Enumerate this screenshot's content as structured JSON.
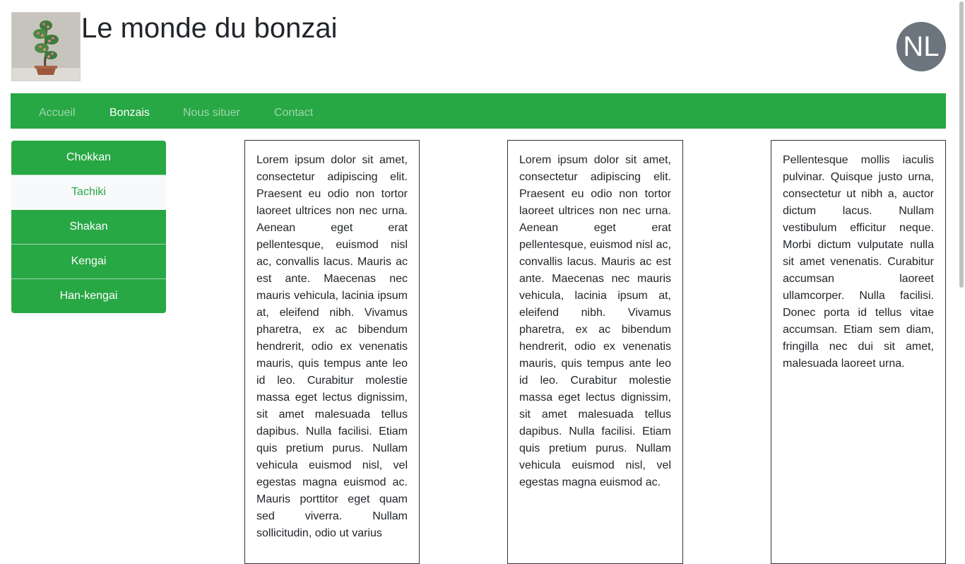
{
  "header": {
    "title": "Le monde du bonzai",
    "avatar_initials": "NL",
    "logo_alt": "bonsai tree"
  },
  "navbar": {
    "items": [
      {
        "label": "Accueil",
        "active": false
      },
      {
        "label": "Bonzais",
        "active": true
      },
      {
        "label": "Nous situer",
        "active": false
      },
      {
        "label": "Contact",
        "active": false
      }
    ],
    "background": "#28a745"
  },
  "sidebar": {
    "items": [
      {
        "label": "Chokkan",
        "active": false
      },
      {
        "label": "Tachiki",
        "active": true
      },
      {
        "label": "Shakan",
        "active": false
      },
      {
        "label": "Kengai",
        "active": false
      },
      {
        "label": "Han-kengai",
        "active": false
      }
    ]
  },
  "columns": [
    {
      "text": "Lorem ipsum dolor sit amet, consectetur adipiscing elit. Praesent eu odio non tortor laoreet ultrices non nec urna. Aenean eget erat pellentesque, euismod nisl ac, convallis lacus. Mauris ac est ante. Maecenas nec mauris vehicula, lacinia ipsum at, eleifend nibh. Vivamus pharetra, ex ac bibendum hendrerit, odio ex venenatis mauris, quis tempus ante leo id leo. Curabitur molestie massa eget lectus dignissim, sit amet malesuada tellus dapibus. Nulla facilisi. Etiam quis pretium purus. Nullam vehicula euismod nisl, vel egestas magna euismod ac. Mauris porttitor eget quam sed viverra. Nullam sollicitudin, odio ut varius"
    },
    {
      "text": "Lorem ipsum dolor sit amet, consectetur adipiscing elit. Praesent eu odio non tortor laoreet ultrices non nec urna. Aenean eget erat pellentesque, euismod nisl ac, convallis lacus. Mauris ac est ante. Maecenas nec mauris vehicula, lacinia ipsum at, eleifend nibh. Vivamus pharetra, ex ac bibendum hendrerit, odio ex venenatis mauris, quis tempus ante leo id leo. Curabitur molestie massa eget lectus dignissim, sit amet malesuada tellus dapibus. Nulla facilisi. Etiam quis pretium purus. Nullam vehicula euismod nisl, vel egestas magna euismod ac."
    },
    {
      "text": "Pellentesque mollis iaculis pulvinar. Quisque justo urna, consectetur ut nibh a, auctor dictum lacus. Nullam vestibulum efficitur neque. Morbi dictum vulputate nulla sit amet venenatis. Curabitur accumsan laoreet ullamcorper. Nulla facilisi. Donec porta id tellus vitae accumsan. Etiam sem diam, fringilla nec dui sit amet, malesuada laoreet urna."
    }
  ],
  "colors": {
    "accent_green": "#28a745",
    "avatar_gray": "#6c757d",
    "text": "#212529"
  }
}
